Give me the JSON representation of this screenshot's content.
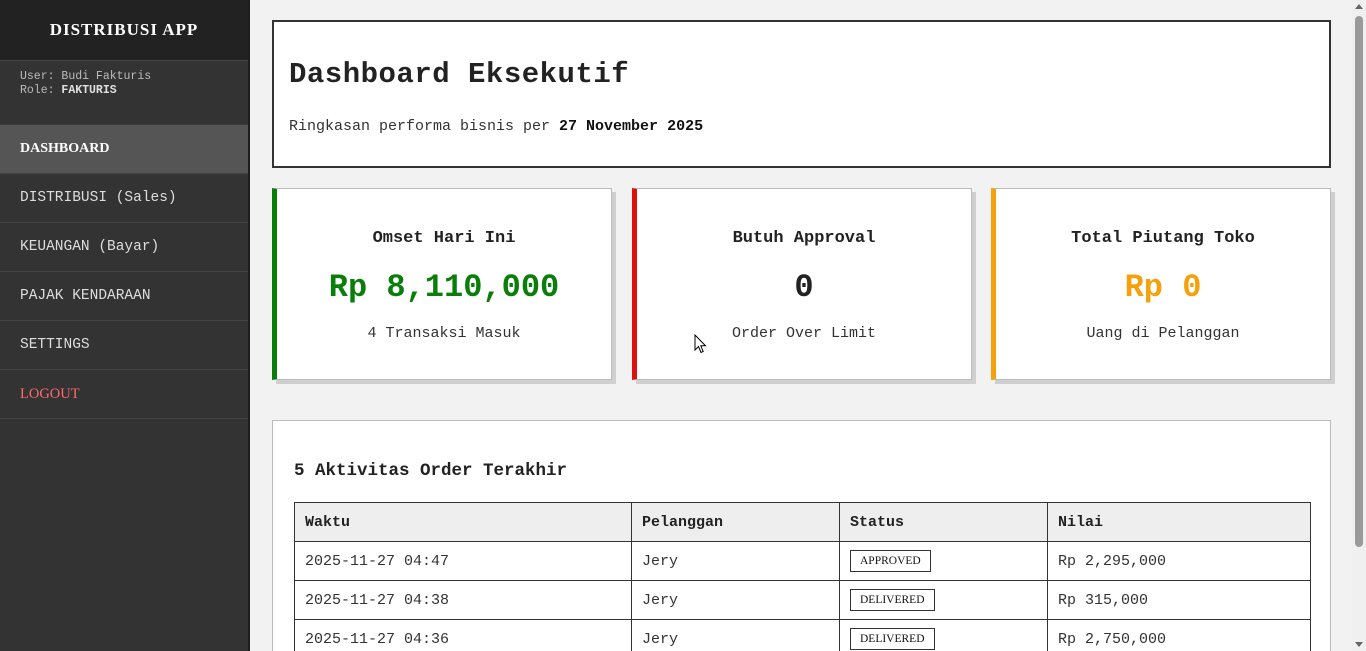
{
  "sidebar": {
    "brand": "DISTRIBUSI APP",
    "user_prefix": "User: ",
    "user_name": "Budi Fakturis",
    "role_prefix": "Role: ",
    "role": "FAKTURIS",
    "items": [
      {
        "label": "DASHBOARD"
      },
      {
        "label": "DISTRIBUSI (Sales)"
      },
      {
        "label": "KEUANGAN (Bayar)"
      },
      {
        "label": "PAJAK KENDARAAN"
      },
      {
        "label": "SETTINGS"
      },
      {
        "label": "LOGOUT"
      }
    ]
  },
  "header": {
    "title": "Dashboard Eksekutif",
    "subtitle_prefix": "Ringkasan performa bisnis per ",
    "date": "27 November 2025"
  },
  "cards": [
    {
      "title": "Omset Hari Ini",
      "value": "Rp 8,110,000",
      "sub": "4 Transaksi Masuk",
      "color": "#0a7e0a"
    },
    {
      "title": "Butuh Approval",
      "value": "0",
      "sub": "Order Over Limit",
      "color": "#222222"
    },
    {
      "title": "Total Piutang Toko",
      "value": "Rp 0",
      "sub": "Uang di Pelanggan",
      "color": "#f4a10c"
    }
  ],
  "orders": {
    "title": "5 Aktivitas Order Terakhir",
    "columns": [
      "Waktu",
      "Pelanggan",
      "Status",
      "Nilai"
    ],
    "rows": [
      {
        "waktu": "2025-11-27 04:47",
        "pelanggan": "Jery",
        "status": "APPROVED",
        "nilai": "Rp 2,295,000"
      },
      {
        "waktu": "2025-11-27 04:38",
        "pelanggan": "Jery",
        "status": "DELIVERED",
        "nilai": "Rp 315,000"
      },
      {
        "waktu": "2025-11-27 04:36",
        "pelanggan": "Jery",
        "status": "DELIVERED",
        "nilai": "Rp 2,750,000"
      }
    ]
  }
}
